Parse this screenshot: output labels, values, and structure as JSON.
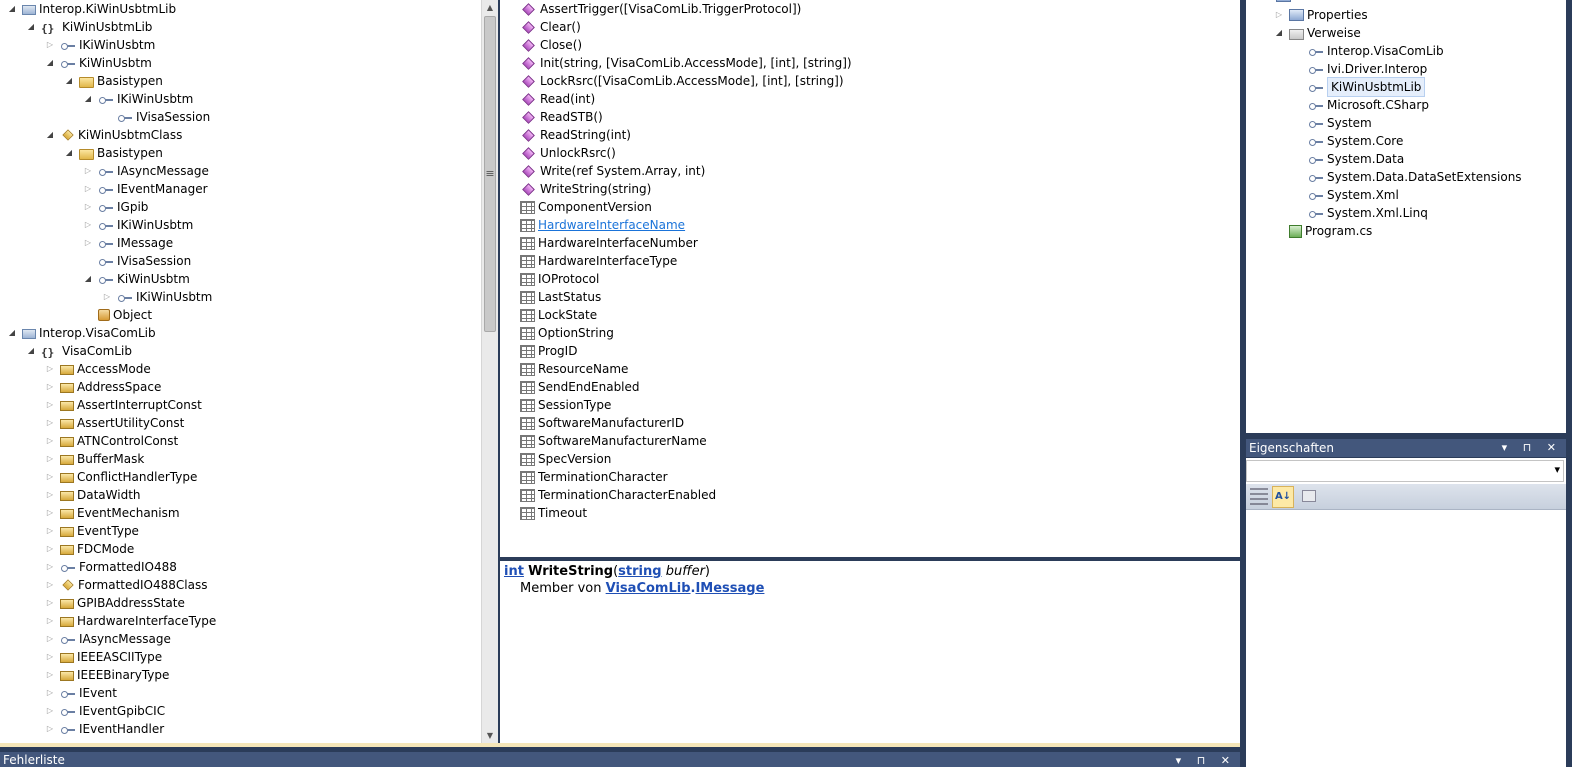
{
  "left_tree": [
    {
      "label": "Interop.KiWinUsbtmLib",
      "icon": "assembly-icon",
      "indent": 0,
      "expander": "expanded"
    },
    {
      "label": "KiWinUsbtmLib",
      "icon": "namespace-icon",
      "indent": 1,
      "expander": "expanded"
    },
    {
      "label": "IKiWinUsbtm",
      "icon": "interface-icon",
      "indent": 2,
      "expander": "collapsed"
    },
    {
      "label": "KiWinUsbtm",
      "icon": "interface-icon",
      "indent": 2,
      "expander": "expanded"
    },
    {
      "label": "Basistypen",
      "icon": "folder-icon",
      "indent": 3,
      "expander": "expanded"
    },
    {
      "label": "IKiWinUsbtm",
      "icon": "interface-icon",
      "indent": 4,
      "expander": "expanded"
    },
    {
      "label": "IVisaSession",
      "icon": "interface-icon",
      "indent": 5,
      "expander": "none"
    },
    {
      "label": "KiWinUsbtmClass",
      "icon": "class-icon",
      "indent": 2,
      "expander": "expanded"
    },
    {
      "label": "Basistypen",
      "icon": "folder-icon",
      "indent": 3,
      "expander": "expanded"
    },
    {
      "label": "IAsyncMessage",
      "icon": "interface-icon",
      "indent": 4,
      "expander": "collapsed"
    },
    {
      "label": "IEventManager",
      "icon": "interface-icon",
      "indent": 4,
      "expander": "collapsed"
    },
    {
      "label": "IGpib",
      "icon": "interface-icon",
      "indent": 4,
      "expander": "collapsed"
    },
    {
      "label": "IKiWinUsbtm",
      "icon": "interface-icon",
      "indent": 4,
      "expander": "collapsed"
    },
    {
      "label": "IMessage",
      "icon": "interface-icon",
      "indent": 4,
      "expander": "collapsed"
    },
    {
      "label": "IVisaSession",
      "icon": "interface-icon",
      "indent": 4,
      "expander": "none"
    },
    {
      "label": "KiWinUsbtm",
      "icon": "interface-icon",
      "indent": 4,
      "expander": "expanded"
    },
    {
      "label": "IKiWinUsbtm",
      "icon": "interface-icon",
      "indent": 5,
      "expander": "collapsed"
    },
    {
      "label": "Object",
      "icon": "object-icon",
      "indent": 4,
      "expander": "none"
    },
    {
      "label": "Interop.VisaComLib",
      "icon": "assembly-icon",
      "indent": 0,
      "expander": "expanded"
    },
    {
      "label": "VisaComLib",
      "icon": "namespace-icon",
      "indent": 1,
      "expander": "expanded"
    },
    {
      "label": "AccessMode",
      "icon": "enum-icon",
      "indent": 2,
      "expander": "collapsed"
    },
    {
      "label": "AddressSpace",
      "icon": "enum-icon",
      "indent": 2,
      "expander": "collapsed"
    },
    {
      "label": "AssertInterruptConst",
      "icon": "enum-icon",
      "indent": 2,
      "expander": "collapsed"
    },
    {
      "label": "AssertUtilityConst",
      "icon": "enum-icon",
      "indent": 2,
      "expander": "collapsed"
    },
    {
      "label": "ATNControlConst",
      "icon": "enum-icon",
      "indent": 2,
      "expander": "collapsed"
    },
    {
      "label": "BufferMask",
      "icon": "enum-icon",
      "indent": 2,
      "expander": "collapsed"
    },
    {
      "label": "ConflictHandlerType",
      "icon": "enum-icon",
      "indent": 2,
      "expander": "collapsed"
    },
    {
      "label": "DataWidth",
      "icon": "enum-icon",
      "indent": 2,
      "expander": "collapsed"
    },
    {
      "label": "EventMechanism",
      "icon": "enum-icon",
      "indent": 2,
      "expander": "collapsed"
    },
    {
      "label": "EventType",
      "icon": "enum-icon",
      "indent": 2,
      "expander": "collapsed"
    },
    {
      "label": "FDCMode",
      "icon": "enum-icon",
      "indent": 2,
      "expander": "collapsed"
    },
    {
      "label": "FormattedIO488",
      "icon": "interface-icon",
      "indent": 2,
      "expander": "collapsed"
    },
    {
      "label": "FormattedIO488Class",
      "icon": "class-icon",
      "indent": 2,
      "expander": "collapsed"
    },
    {
      "label": "GPIBAddressState",
      "icon": "enum-icon",
      "indent": 2,
      "expander": "collapsed"
    },
    {
      "label": "HardwareInterfaceType",
      "icon": "enum-icon",
      "indent": 2,
      "expander": "collapsed"
    },
    {
      "label": "IAsyncMessage",
      "icon": "interface-icon",
      "indent": 2,
      "expander": "collapsed"
    },
    {
      "label": "IEEEASCIIType",
      "icon": "enum-icon",
      "indent": 2,
      "expander": "collapsed"
    },
    {
      "label": "IEEEBinaryType",
      "icon": "enum-icon",
      "indent": 2,
      "expander": "collapsed"
    },
    {
      "label": "IEvent",
      "icon": "interface-icon",
      "indent": 2,
      "expander": "collapsed"
    },
    {
      "label": "IEventGpibCIC",
      "icon": "interface-icon",
      "indent": 2,
      "expander": "collapsed"
    },
    {
      "label": "IEventHandler",
      "icon": "interface-icon",
      "indent": 2,
      "expander": "collapsed"
    }
  ],
  "members": [
    {
      "label": "AssertTrigger([VisaComLib.TriggerProtocol])",
      "kind": "method"
    },
    {
      "label": "Clear()",
      "kind": "method"
    },
    {
      "label": "Close()",
      "kind": "method"
    },
    {
      "label": "Init(string, [VisaComLib.AccessMode], [int], [string])",
      "kind": "method"
    },
    {
      "label": "LockRsrc([VisaComLib.AccessMode], [int], [string])",
      "kind": "method"
    },
    {
      "label": "Read(int)",
      "kind": "method"
    },
    {
      "label": "ReadSTB()",
      "kind": "method"
    },
    {
      "label": "ReadString(int)",
      "kind": "method"
    },
    {
      "label": "UnlockRsrc()",
      "kind": "method"
    },
    {
      "label": "Write(ref System.Array, int)",
      "kind": "method"
    },
    {
      "label": "WriteString(string)",
      "kind": "method"
    },
    {
      "label": "ComponentVersion",
      "kind": "property"
    },
    {
      "label": "HardwareInterfaceName",
      "kind": "property",
      "link": true
    },
    {
      "label": "HardwareInterfaceNumber",
      "kind": "property"
    },
    {
      "label": "HardwareInterfaceType",
      "kind": "property"
    },
    {
      "label": "IOProtocol",
      "kind": "property"
    },
    {
      "label": "LastStatus",
      "kind": "property"
    },
    {
      "label": "LockState",
      "kind": "property"
    },
    {
      "label": "OptionString",
      "kind": "property"
    },
    {
      "label": "ProgID",
      "kind": "property"
    },
    {
      "label": "ResourceName",
      "kind": "property"
    },
    {
      "label": "SendEndEnabled",
      "kind": "property"
    },
    {
      "label": "SessionType",
      "kind": "property"
    },
    {
      "label": "SoftwareManufacturerID",
      "kind": "property"
    },
    {
      "label": "SoftwareManufacturerName",
      "kind": "property"
    },
    {
      "label": "SpecVersion",
      "kind": "property"
    },
    {
      "label": "TerminationCharacter",
      "kind": "property"
    },
    {
      "label": "TerminationCharacterEnabled",
      "kind": "property"
    },
    {
      "label": "Timeout",
      "kind": "property"
    }
  ],
  "description": {
    "return_type": "int",
    "method_name": "WriteString",
    "open_paren": "(",
    "param_type": "string",
    "param_name": "buffer",
    "close_paren": ")",
    "member_of_label": "Member von",
    "member_of_ns": "VisaComLib",
    "dot": ".",
    "member_of_type": "IMessage"
  },
  "solution_tree": [
    {
      "label": "Properties",
      "icon": "properties-icon",
      "indent": 1,
      "expander": "collapsed"
    },
    {
      "label": "Verweise",
      "icon": "references-folder-icon",
      "indent": 1,
      "expander": "expanded"
    },
    {
      "label": "Interop.VisaComLib",
      "icon": "reference-icon",
      "indent": 2,
      "expander": "none"
    },
    {
      "label": "Ivi.Driver.Interop",
      "icon": "reference-icon",
      "indent": 2,
      "expander": "none"
    },
    {
      "label": "KiWinUsbtmLib",
      "icon": "reference-icon",
      "indent": 2,
      "expander": "none",
      "selected": true
    },
    {
      "label": "Microsoft.CSharp",
      "icon": "reference-icon",
      "indent": 2,
      "expander": "none"
    },
    {
      "label": "System",
      "icon": "reference-icon",
      "indent": 2,
      "expander": "none"
    },
    {
      "label": "System.Core",
      "icon": "reference-icon",
      "indent": 2,
      "expander": "none"
    },
    {
      "label": "System.Data",
      "icon": "reference-icon",
      "indent": 2,
      "expander": "none"
    },
    {
      "label": "System.Data.DataSetExtensions",
      "icon": "reference-icon",
      "indent": 2,
      "expander": "none"
    },
    {
      "label": "System.Xml",
      "icon": "reference-icon",
      "indent": 2,
      "expander": "none"
    },
    {
      "label": "System.Xml.Linq",
      "icon": "reference-icon",
      "indent": 2,
      "expander": "none"
    },
    {
      "label": "Program.cs",
      "icon": "csharp-file-icon",
      "indent": 1,
      "expander": "none"
    }
  ],
  "properties_panel": {
    "title": "Eigenschaften",
    "selector_value": "",
    "title_buttons": "▾ ⊓ ✕"
  },
  "error_list": {
    "title": "Fehlerliste",
    "title_buttons": "▾ ⊓ ✕"
  },
  "glyphs": {
    "expanded": "◢",
    "collapsed": "▷",
    "namespace": "{}",
    "dropdown": "▾",
    "up": "▲",
    "down": "▼",
    "grip": "≡"
  },
  "colors": {
    "chrome": "#2b3c59",
    "link": "#1a73d9",
    "keyword": "#1f4fb5"
  }
}
